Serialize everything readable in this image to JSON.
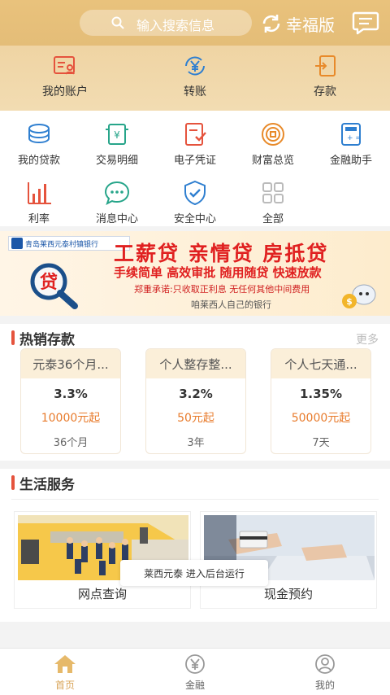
{
  "header": {
    "search_placeholder": "输入搜索信息",
    "mode_label": "幸福版"
  },
  "quick_actions": [
    {
      "label": "我的账户",
      "icon": "account-card-icon"
    },
    {
      "label": "转账",
      "icon": "yuan-transfer-icon"
    },
    {
      "label": "存款",
      "icon": "deposit-icon"
    }
  ],
  "grid_items": [
    {
      "label": "我的贷款",
      "icon": "loan-icon"
    },
    {
      "label": "交易明细",
      "icon": "transaction-icon"
    },
    {
      "label": "电子凭证",
      "icon": "voucher-icon"
    },
    {
      "label": "财富总览",
      "icon": "wealth-icon"
    },
    {
      "label": "金融助手",
      "icon": "calculator-icon"
    },
    {
      "label": "利率",
      "icon": "bar-chart-icon"
    },
    {
      "label": "消息中心",
      "icon": "chat-icon"
    },
    {
      "label": "安全中心",
      "icon": "shield-icon"
    },
    {
      "label": "全部",
      "icon": "grid-icon"
    }
  ],
  "banner": {
    "bank_name": "青岛莱西元泰村镇银行",
    "title": "工薪贷  亲情贷  房抵贷",
    "subtitle": "手续简单  高效审批  随用随贷  快速放款",
    "note": "郑重承诺:只收取正利息 无任何其他中间费用",
    "slogan": "咱莱西人自己的银行",
    "badge": "贷"
  },
  "hot_deposits": {
    "title": "热销存款",
    "more": "更多",
    "products": [
      {
        "name": "元泰36个月...",
        "rate": "3.3%",
        "min": "10000元起",
        "term": "36个月"
      },
      {
        "name": "个人整存整...",
        "rate": "3.2%",
        "min": "50元起",
        "term": "3年"
      },
      {
        "name": "个人七天通...",
        "rate": "1.35%",
        "min": "50000元起",
        "term": "7天"
      }
    ]
  },
  "life_services": {
    "title": "生活服务",
    "items": [
      {
        "label": "网点查询"
      },
      {
        "label": "现金预约"
      }
    ]
  },
  "toast": "莱西元泰 进入后台运行",
  "tabbar": [
    {
      "label": "首页",
      "active": true
    },
    {
      "label": "金融",
      "active": false
    },
    {
      "label": "我的",
      "active": false
    }
  ],
  "colors": {
    "header": "#e4bd78",
    "accent_red": "#e5533d",
    "accent_orange": "#e87b2c",
    "tab_active": "#d9a55a"
  }
}
